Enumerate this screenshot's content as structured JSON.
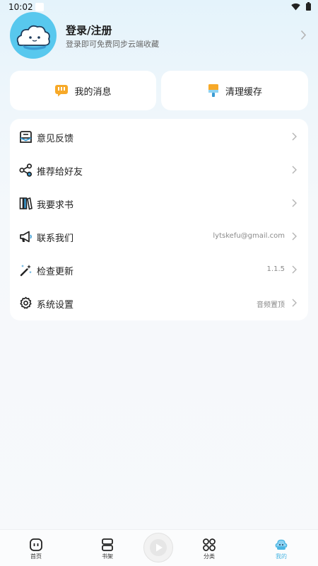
{
  "status_bar": {
    "time": "10:02"
  },
  "profile": {
    "title": "登录/注册",
    "subtitle": "登录即可免费同步云端收藏"
  },
  "quick_actions": [
    {
      "label": "我的消息",
      "icon": "message-icon"
    },
    {
      "label": "清理缓存",
      "icon": "broom-icon"
    }
  ],
  "menu": [
    {
      "label": "意见反馈",
      "value": "",
      "icon": "feedback-icon"
    },
    {
      "label": "推荐给好友",
      "value": "",
      "icon": "share-icon"
    },
    {
      "label": "我要求书",
      "value": "",
      "icon": "books-icon"
    },
    {
      "label": "联系我们",
      "value": "lytskefu@gmail.com",
      "icon": "megaphone-icon"
    },
    {
      "label": "检查更新",
      "value": "1.1.5",
      "icon": "magic-wand-icon"
    },
    {
      "label": "系统设置",
      "value": "音频置顶",
      "icon": "gear-icon"
    }
  ],
  "bottom_nav": [
    {
      "label": "首页",
      "icon": "home-icon",
      "active": false
    },
    {
      "label": "书架",
      "icon": "bookshelf-icon",
      "active": false
    },
    {
      "label": "分类",
      "icon": "category-icon",
      "active": false
    },
    {
      "label": "我的",
      "icon": "profile-icon",
      "active": true
    }
  ],
  "colors": {
    "accent": "#4bb6e3",
    "avatar_bg": "#58c8ee"
  }
}
